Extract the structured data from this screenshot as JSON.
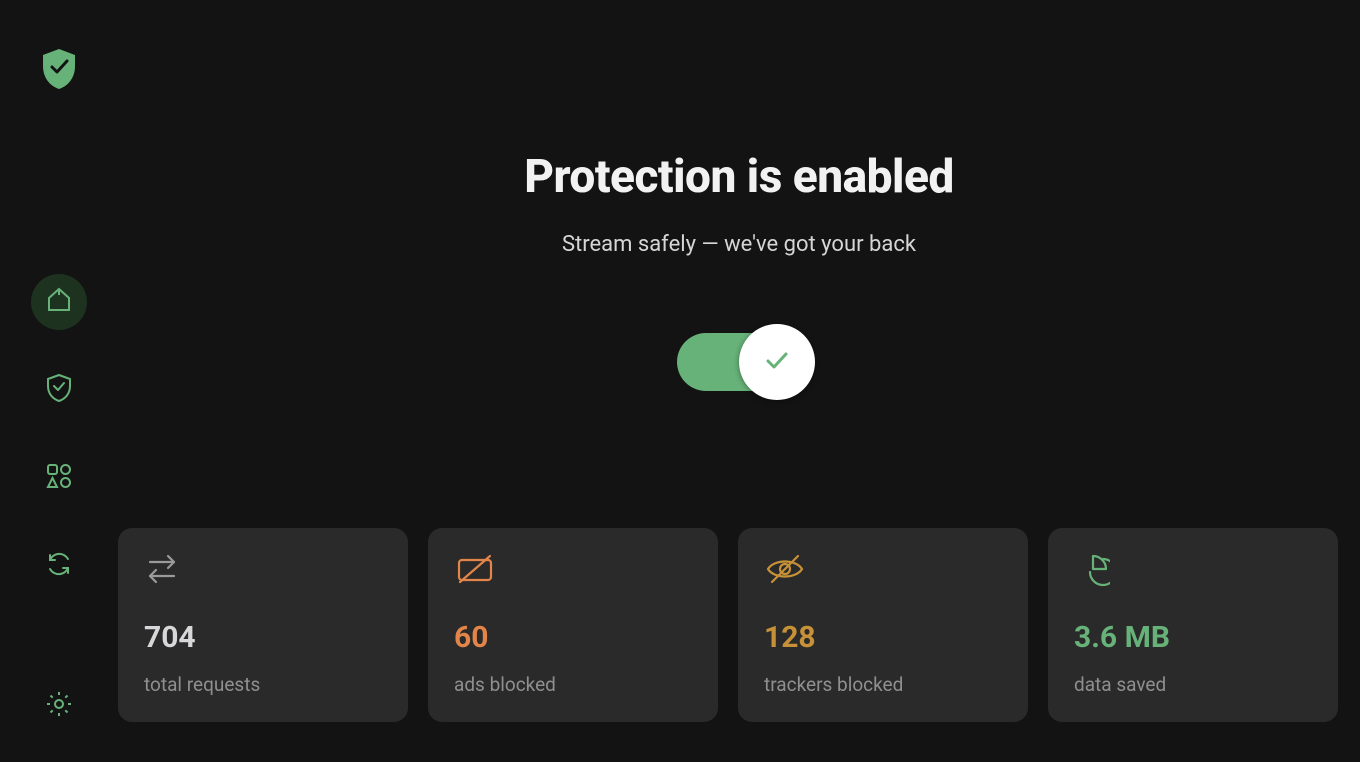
{
  "colors": {
    "accent_green": "#67b279",
    "accent_orange": "#e38549",
    "accent_amber": "#c79237",
    "background": "#131313",
    "card_background": "#2a2a2a"
  },
  "brand": {
    "logo_icon": "shield-check"
  },
  "nav": {
    "items": [
      {
        "icon": "home-icon",
        "active": true
      },
      {
        "icon": "shield-outline-icon",
        "active": false
      },
      {
        "icon": "apps-icon",
        "active": false
      },
      {
        "icon": "sync-icon",
        "active": false
      }
    ],
    "settings_icon": "gear-icon"
  },
  "hero": {
    "title": "Protection is enabled",
    "subtitle": "Stream safely — we've got your back"
  },
  "toggle": {
    "state": "on",
    "knob_icon": "checkmark-icon"
  },
  "stats": [
    {
      "icon": "arrows-exchange-icon",
      "value": "704",
      "label": "total requests",
      "color_class": "v-white"
    },
    {
      "icon": "ad-blocked-icon",
      "value": "60",
      "label": "ads blocked",
      "color_class": "v-orange"
    },
    {
      "icon": "tracker-blocked-icon",
      "value": "128",
      "label": "trackers blocked",
      "color_class": "v-amber"
    },
    {
      "icon": "pie-chart-icon",
      "value": "3.6 MB",
      "label": "data saved",
      "color_class": "v-green"
    }
  ]
}
